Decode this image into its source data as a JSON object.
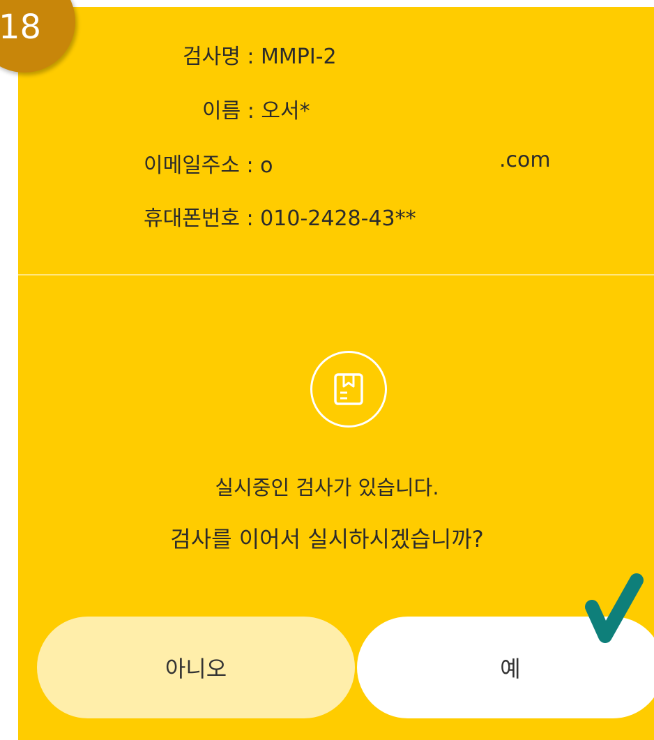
{
  "step": {
    "number": "18"
  },
  "info": {
    "test_name": "검사명 : MMPI-2",
    "name": "이름 : 오서*",
    "email_prefix": "이메일주소 : o",
    "email_suffix": ".com",
    "phone": "휴대폰번호 : 010-2428-43**"
  },
  "dialog": {
    "icon": "clipboard-icon",
    "message_line1": "실시중인 검사가 있습니다.",
    "message_line2": "검사를 이어서 실시하시겠습니까?"
  },
  "buttons": {
    "no_label": "아니오",
    "yes_label": "예"
  },
  "annotation": {
    "icon": "checkmark-icon",
    "color": "#0e7f7a"
  },
  "colors": {
    "panel": "#ffcc00",
    "badge": "#c8860a",
    "no_button": "#ffeeaa",
    "yes_button": "#ffffff"
  }
}
